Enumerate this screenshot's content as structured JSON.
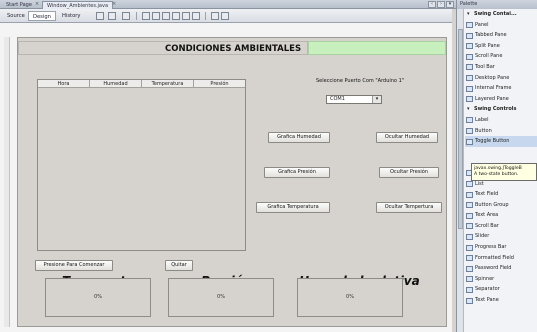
{
  "top_tabs": [
    {
      "label": "Start Page",
      "active": false
    },
    {
      "label": "Window_Ambientes.java",
      "active": true
    }
  ],
  "toolbar": {
    "tabs": [
      {
        "label": "Source"
      },
      {
        "label": "Design"
      },
      {
        "label": "History"
      }
    ],
    "active_tab": "Design"
  },
  "form": {
    "title": "CONDICIONES AMBIENTALES",
    "table_headers": [
      "Hora",
      "Humedad",
      "Temperatura",
      "Presión"
    ],
    "port_label": "Seleccione Puerto Com \"Arduino 1\"",
    "port_value": "COM1",
    "buttons": {
      "graph_humidity": "Grafica Humedad",
      "hide_humidity": "Ocultar Humedad",
      "graph_pressure": "Grafica Presión",
      "hide_pressure": "Ocultar Presión",
      "graph_temperature": "Grafica Temperatura",
      "hide_temperature": "Ocultar Tempertura",
      "start": "Presione Para Comenzar",
      "quit": "Quitar"
    },
    "labels": {
      "temperature": "Temperatura",
      "pressure": "Presión",
      "humidity": "Humedad relativa"
    },
    "gauges": {
      "temperature": "0%",
      "pressure": "0%",
      "humidity": "0%"
    }
  },
  "palette": {
    "header": "Palette",
    "items": [
      {
        "label": "Swing Contai...",
        "category": true
      },
      {
        "label": "Panel"
      },
      {
        "label": "Tabbed Pane"
      },
      {
        "label": "Split Pane"
      },
      {
        "label": "Scroll Pane"
      },
      {
        "label": "Tool Bar"
      },
      {
        "label": "Desktop Pane"
      },
      {
        "label": "Internal Frame"
      },
      {
        "label": "Layered Pane"
      },
      {
        "label": "Swing Controls",
        "category": true
      },
      {
        "label": "Label"
      },
      {
        "label": "Button"
      },
      {
        "label": "Toggle Button",
        "selected": true
      },
      {
        "label": ""
      },
      {
        "label": ""
      },
      {
        "label": "Combo Box"
      },
      {
        "label": "List"
      },
      {
        "label": "Text Field"
      },
      {
        "label": "Button Group"
      },
      {
        "label": "Text Area"
      },
      {
        "label": "Scroll Bar"
      },
      {
        "label": "Slider"
      },
      {
        "label": "Progress Bar"
      },
      {
        "label": "Formatted Field"
      },
      {
        "label": "Password Field"
      },
      {
        "label": "Spinner"
      },
      {
        "label": "Separator"
      },
      {
        "label": "Text Pane"
      }
    ],
    "tooltip_line1": "javax.swing.JToggleB",
    "tooltip_line2": "A two-state button."
  }
}
